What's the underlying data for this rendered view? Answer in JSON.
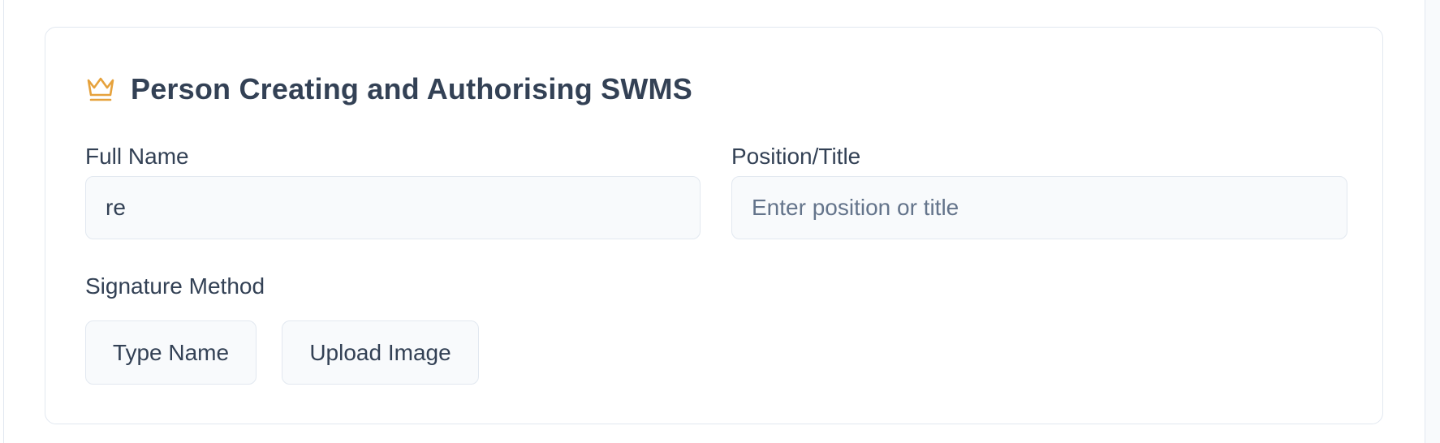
{
  "section": {
    "title": "Person Creating and Authorising SWMS",
    "icon": "crown-icon",
    "accent_color": "#e6a23c"
  },
  "form": {
    "full_name": {
      "label": "Full Name",
      "value": "re"
    },
    "position": {
      "label": "Position/Title",
      "value": "",
      "placeholder": "Enter position or title"
    },
    "signature_method": {
      "label": "Signature Method",
      "options": [
        "Type Name",
        "Upload Image"
      ]
    }
  }
}
